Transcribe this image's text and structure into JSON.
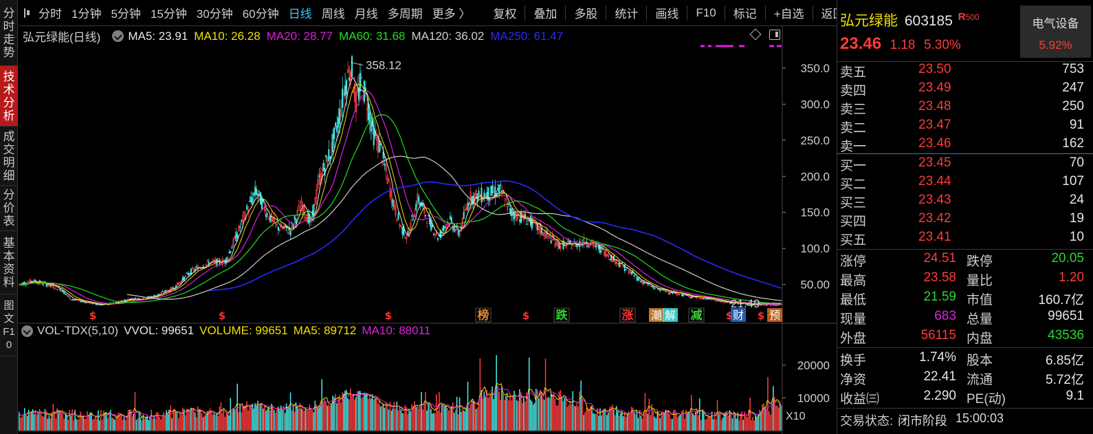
{
  "sidebar": {
    "tabs": [
      {
        "label": "分时走势",
        "active": false
      },
      {
        "label": "技术分析",
        "active": true
      },
      {
        "label": "成交明细",
        "active": false
      },
      {
        "label": "分价表",
        "active": false
      },
      {
        "label": "基本资料",
        "active": false
      },
      {
        "label": "图文F10",
        "active": false
      }
    ]
  },
  "toolbar": {
    "periods": [
      "分时",
      "1分钟",
      "5分钟",
      "15分钟",
      "30分钟",
      "60分钟",
      "日线",
      "周线",
      "月线",
      "多周期",
      "更多 〉"
    ],
    "active_period": "日线",
    "tools": [
      "复权",
      "叠加",
      "多股",
      "统计",
      "画线",
      "F10",
      "标记",
      "+自选",
      "返回"
    ]
  },
  "legend": {
    "stock_label": "弘元绿能(日线)",
    "ma5": "MA5: 23.91",
    "ma10": "MA10: 26.28",
    "ma20": "MA20: 28.77",
    "ma60": "MA60: 31.68",
    "ma120": "MA120: 36.02",
    "ma250": "MA250: 61.47"
  },
  "volume_legend": {
    "indicator": "VOL-TDX(5,10)",
    "vvol": "VVOL: 99651",
    "volume": "VOLUME: 99651",
    "ma5": "MA5: 89712",
    "ma10": "MA10: 88011"
  },
  "price_axis": [
    "350.0",
    "300.0",
    "250.0",
    "200.0",
    "150.0",
    "100.0",
    "50.00"
  ],
  "volume_axis": [
    "20000",
    "10000"
  ],
  "volume_unit": "X10",
  "peak_label": "358.12",
  "low_label": "21.49",
  "markers": [
    {
      "text": "$",
      "color": "#ff3030"
    },
    {
      "text": "$",
      "color": "#ff3030"
    },
    {
      "text": "$",
      "color": "#ff3030"
    },
    {
      "text": "榜",
      "color": "#e08a30"
    },
    {
      "text": "$",
      "color": "#ff3030"
    },
    {
      "text": "跌",
      "color": "#2fd52f"
    },
    {
      "text": "涨",
      "color": "#ff3030"
    },
    {
      "text": "减",
      "color": "#2fd52f"
    },
    {
      "text": "$",
      "color": "#ff3030"
    },
    {
      "text": "$",
      "color": "#ff3030"
    }
  ],
  "badges": [
    "潮",
    "解",
    "财",
    "预"
  ],
  "colors": {
    "ma5": "#e6e6e6",
    "ma10": "#f2e100",
    "ma20": "#e020e0",
    "ma60": "#20e020",
    "ma120": "#cfcfcf",
    "ma250": "#2a2aff",
    "up": "#ff3b3b",
    "down": "#44e8e8",
    "accent_blue": "#3ec6ff"
  },
  "quote": {
    "name": "弘元绿能",
    "code": "603185",
    "r_badge": "R",
    "r_number": "500",
    "sector": "电气设备",
    "sector_change": "5.92%",
    "price": "23.46",
    "change": "1.18",
    "change_pct": "5.30%"
  },
  "orderbook": {
    "asks": [
      {
        "label": "卖五",
        "price": "23.50",
        "volume": "753"
      },
      {
        "label": "卖四",
        "price": "23.49",
        "volume": "247"
      },
      {
        "label": "卖三",
        "price": "23.48",
        "volume": "250"
      },
      {
        "label": "卖二",
        "price": "23.47",
        "volume": "91"
      },
      {
        "label": "卖一",
        "price": "23.46",
        "volume": "162"
      }
    ],
    "bids": [
      {
        "label": "买一",
        "price": "23.45",
        "volume": "70"
      },
      {
        "label": "买二",
        "price": "23.44",
        "volume": "107"
      },
      {
        "label": "买三",
        "price": "23.43",
        "volume": "24"
      },
      {
        "label": "买四",
        "price": "23.42",
        "volume": "19"
      },
      {
        "label": "买五",
        "price": "23.41",
        "volume": "10"
      }
    ]
  },
  "stats": {
    "zhangting_l": "涨停",
    "zhangting_v": "24.51",
    "dieting_l": "跌停",
    "dieting_v": "20.05",
    "zuigao_l": "最高",
    "zuigao_v": "23.58",
    "liangbi_l": "量比",
    "liangbi_v": "1.20",
    "zuidi_l": "最低",
    "zuidi_v": "21.59",
    "shizhi_l": "市值",
    "shizhi_v": "160.7亿",
    "xianliang_l": "现量",
    "xianliang_v": "683",
    "zongliang_l": "总量",
    "zongliang_v": "99651",
    "waipan_l": "外盘",
    "waipan_v": "56115",
    "neipan_l": "内盘",
    "neipan_v": "43536",
    "huanshou_l": "换手",
    "huanshou_v": "1.74%",
    "guben_l": "股本",
    "guben_v": "6.85亿",
    "jingzi_l": "净资",
    "jingzi_v": "22.41",
    "liutong_l": "流通",
    "liutong_v": "5.72亿",
    "shouyi_l": "收益㈢",
    "shouyi_v": "2.290",
    "pe_l": "PE(动)",
    "pe_v": "9.1",
    "status_label": "交易状态:",
    "status_value": "闭市阶段",
    "status_time": "15:00:03"
  }
}
